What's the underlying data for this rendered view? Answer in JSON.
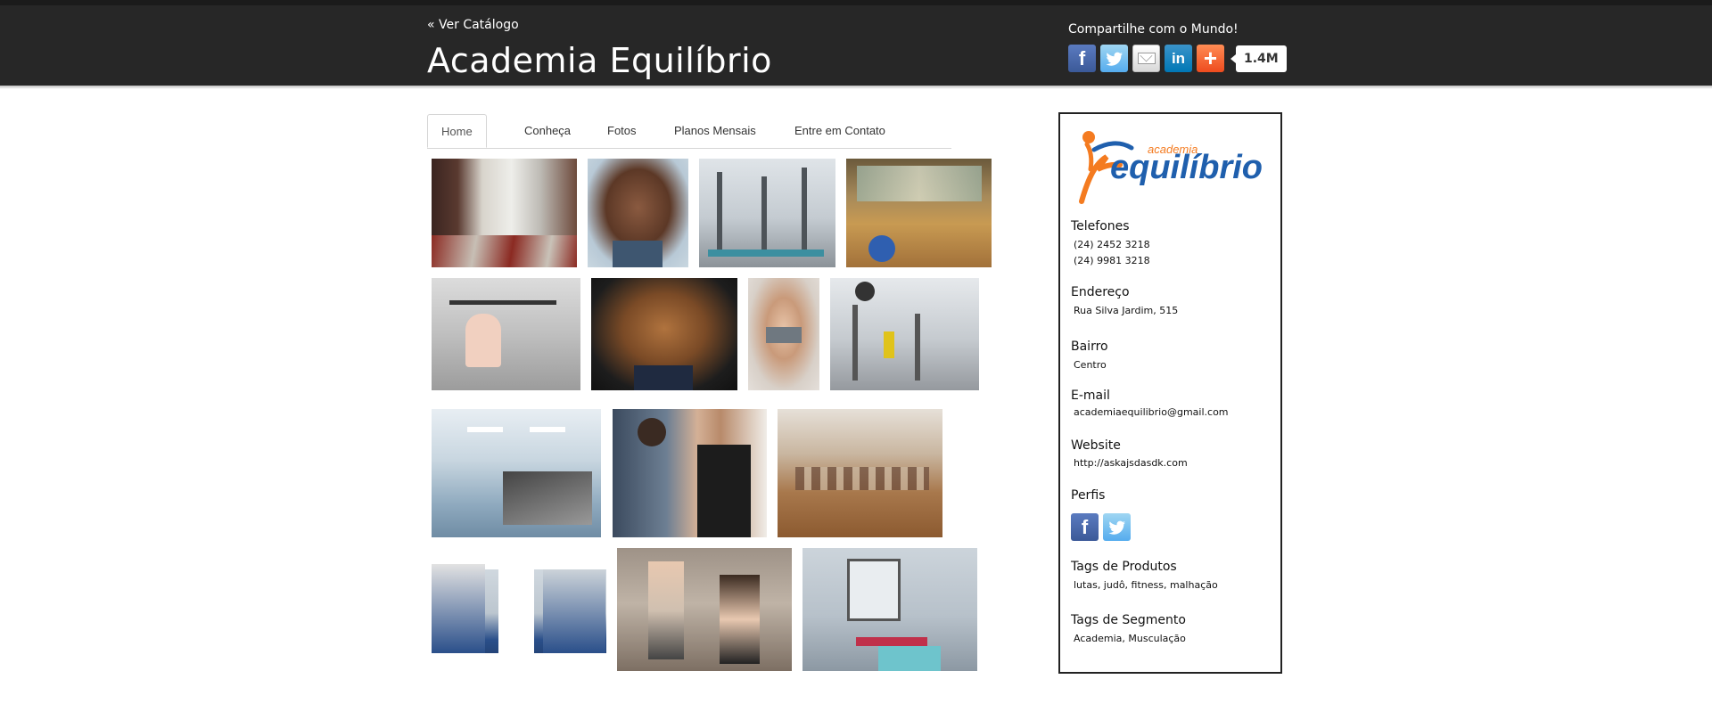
{
  "header": {
    "back_link": "« Ver Catálogo",
    "site_title": "Academia Equilíbrio",
    "share_label": "Compartilhe com o Mundo!",
    "share_count": "1.4M",
    "share_icons": [
      "facebook-icon",
      "twitter-icon",
      "email-icon",
      "linkedin-icon",
      "plus-icon"
    ],
    "colors": {
      "background": "#272727",
      "text": "#ffffff"
    }
  },
  "nav": {
    "tabs": [
      {
        "label": "Home",
        "active": true
      },
      {
        "label": "Conheça",
        "active": false
      },
      {
        "label": "Fotos",
        "active": false
      },
      {
        "label": "Planos Mensais",
        "active": false
      },
      {
        "label": "Entre em Contato",
        "active": false
      }
    ]
  },
  "gallery": {
    "photo_count": 14
  },
  "sidebar": {
    "logo": {
      "small_text": "academia",
      "main_text": "equilíbrio",
      "colors": {
        "orange": "#f47b20",
        "blue": "#1f5fad"
      }
    },
    "telefones_label": "Telefones",
    "telefone_1": "(24) 2452 3218",
    "telefone_2": "(24) 9981 3218",
    "endereco_label": "Endereço",
    "endereco": "Rua Silva Jardim, 515",
    "bairro_label": "Bairro",
    "bairro": "Centro",
    "email_label": "E-mail",
    "email": "academiaequilibrio@gmail.com",
    "website_label": "Website",
    "website": "http://askajsdasdk.com",
    "perfis_label": "Perfis",
    "perfis_icons": [
      "facebook-icon",
      "twitter-icon"
    ],
    "tags_produtos_label": "Tags de Produtos",
    "tags_produtos": "lutas, judô, fitness, malhação",
    "tags_segmento_label": "Tags de Segmento",
    "tags_segmento": "Academia, Musculação"
  }
}
